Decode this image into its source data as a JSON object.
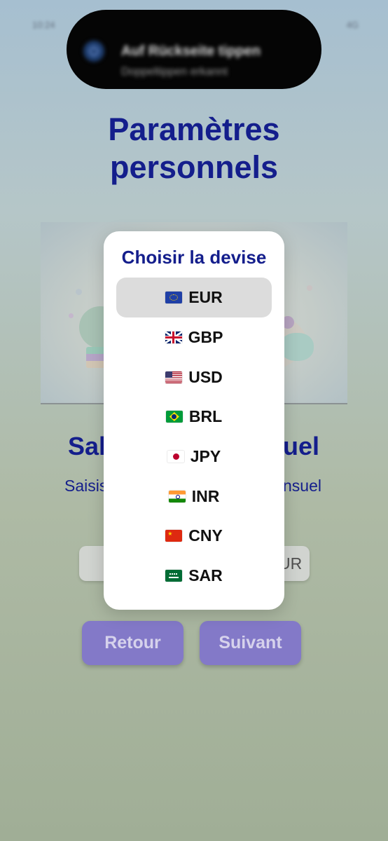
{
  "status_bar": {
    "time": "10:24",
    "signal": "4G"
  },
  "notification": {
    "line1": "Auf Rückseite tippen",
    "line2": "Doppeltippen erkannt"
  },
  "page": {
    "title_line1": "Paramètres",
    "title_line2": "personnels"
  },
  "section": {
    "title_left": "Sal",
    "title_right": "uel",
    "subtitle_left": "Saisis",
    "subtitle_right": "nsuel"
  },
  "amount_field": {
    "currency_suffix": "UR"
  },
  "buttons": {
    "back": "Retour",
    "next": "Suivant"
  },
  "currency_picker": {
    "title": "Choisir la devise",
    "selected": "EUR",
    "options": [
      {
        "code": "EUR",
        "flag": "eu-flag-icon"
      },
      {
        "code": "GBP",
        "flag": "uk-flag-icon"
      },
      {
        "code": "USD",
        "flag": "us-flag-icon"
      },
      {
        "code": "BRL",
        "flag": "brazil-flag-icon"
      },
      {
        "code": "JPY",
        "flag": "japan-flag-icon"
      },
      {
        "code": "INR",
        "flag": "india-flag-icon"
      },
      {
        "code": "CNY",
        "flag": "china-flag-icon"
      },
      {
        "code": "SAR",
        "flag": "saudi-flag-icon"
      }
    ]
  },
  "colors": {
    "accent": "#141e8c",
    "button": "#8379c8",
    "selected_option": "#dcdcdc"
  }
}
